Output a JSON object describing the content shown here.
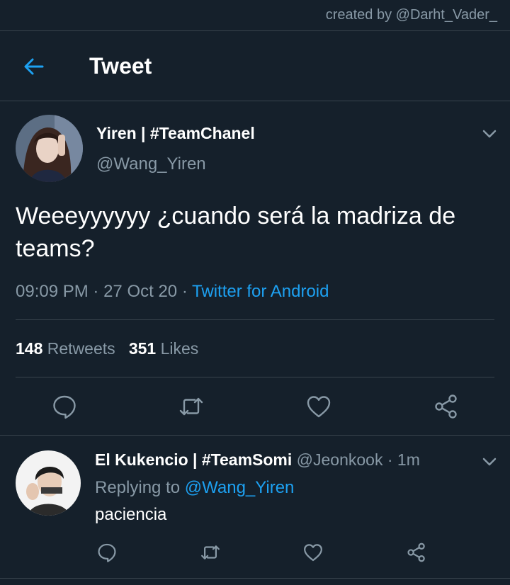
{
  "watermark": "created by @Darht_Vader_",
  "appbar": {
    "title": "Tweet"
  },
  "tweet": {
    "author_name": "Yiren | #TeamChanel",
    "author_handle": "@Wang_Yiren",
    "text": "Weeeyyyyyy ¿cuando será la madriza de teams?",
    "time": "09:09 PM",
    "date": "27 Oct 20",
    "separator": "·",
    "source": "Twitter for Android",
    "retweets_count": "148",
    "retweets_label": "Retweets",
    "likes_count": "351",
    "likes_label": "Likes"
  },
  "reply": {
    "author_name": "El Kukencio | #TeamSomi",
    "author_handle": "@Jeonkook",
    "separator": "·",
    "time": "1m",
    "replying_prefix": "Replying to",
    "replying_to": "@Wang_Yiren",
    "text": "paciencia"
  },
  "icons": {
    "back": "arrow-left-icon",
    "caret": "chevron-down-icon",
    "reply": "comment-icon",
    "retweet": "retweet-icon",
    "like": "heart-icon",
    "share": "share-icon"
  },
  "colors": {
    "background": "#15202b",
    "divider": "#38444d",
    "accent": "#1da1f2",
    "secondary_text": "#8899a6",
    "primary_text": "#ffffff"
  }
}
